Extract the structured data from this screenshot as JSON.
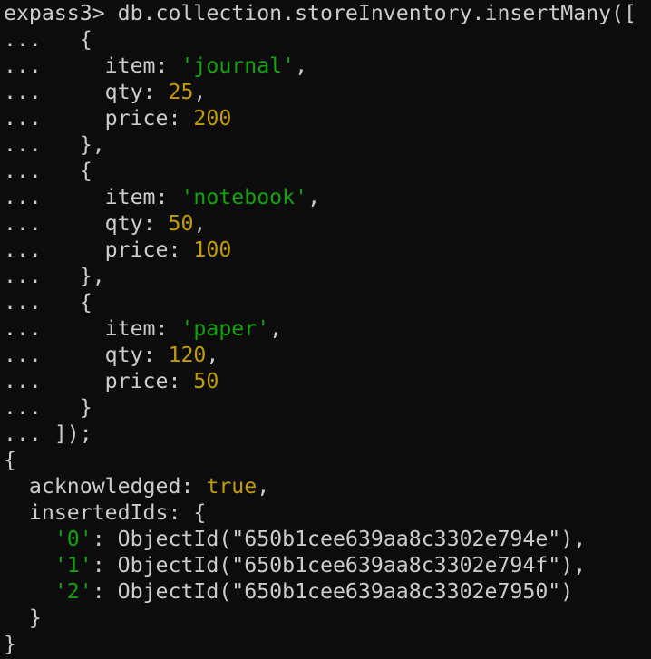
{
  "window": {
    "background": "#0c0c0c"
  },
  "colors": {
    "text": "#cccccc",
    "string": "#13a10e",
    "number": "#c19c00",
    "boolean": "#c19c00"
  },
  "lines": [
    [
      {
        "t": "expass3> db.collection.storeInventory.insertMany([",
        "c": "plain"
      }
    ],
    [
      {
        "t": "...   {",
        "c": "plain"
      }
    ],
    [
      {
        "t": "...     item: ",
        "c": "plain"
      },
      {
        "t": "'journal'",
        "c": "str"
      },
      {
        "t": ",",
        "c": "plain"
      }
    ],
    [
      {
        "t": "...     qty: ",
        "c": "plain"
      },
      {
        "t": "25",
        "c": "num"
      },
      {
        "t": ",",
        "c": "plain"
      }
    ],
    [
      {
        "t": "...     price: ",
        "c": "plain"
      },
      {
        "t": "200",
        "c": "num"
      }
    ],
    [
      {
        "t": "...   },",
        "c": "plain"
      }
    ],
    [
      {
        "t": "...   {",
        "c": "plain"
      }
    ],
    [
      {
        "t": "...     item: ",
        "c": "plain"
      },
      {
        "t": "'notebook'",
        "c": "str"
      },
      {
        "t": ",",
        "c": "plain"
      }
    ],
    [
      {
        "t": "...     qty: ",
        "c": "plain"
      },
      {
        "t": "50",
        "c": "num"
      },
      {
        "t": ",",
        "c": "plain"
      }
    ],
    [
      {
        "t": "...     price: ",
        "c": "plain"
      },
      {
        "t": "100",
        "c": "num"
      }
    ],
    [
      {
        "t": "...   },",
        "c": "plain"
      }
    ],
    [
      {
        "t": "...   {",
        "c": "plain"
      }
    ],
    [
      {
        "t": "...     item: ",
        "c": "plain"
      },
      {
        "t": "'paper'",
        "c": "str"
      },
      {
        "t": ",",
        "c": "plain"
      }
    ],
    [
      {
        "t": "...     qty: ",
        "c": "plain"
      },
      {
        "t": "120",
        "c": "num"
      },
      {
        "t": ",",
        "c": "plain"
      }
    ],
    [
      {
        "t": "...     price: ",
        "c": "plain"
      },
      {
        "t": "50",
        "c": "num"
      }
    ],
    [
      {
        "t": "...   }",
        "c": "plain"
      }
    ],
    [
      {
        "t": "... ]);",
        "c": "plain"
      }
    ],
    [
      {
        "t": "{",
        "c": "plain"
      }
    ],
    [
      {
        "t": "  acknowledged: ",
        "c": "plain"
      },
      {
        "t": "true",
        "c": "bool"
      },
      {
        "t": ",",
        "c": "plain"
      }
    ],
    [
      {
        "t": "  insertedIds: {",
        "c": "plain"
      }
    ],
    [
      {
        "t": "    ",
        "c": "plain"
      },
      {
        "t": "'0'",
        "c": "str"
      },
      {
        "t": ": ObjectId(\"650b1cee639aa8c3302e794e\"),",
        "c": "plain"
      }
    ],
    [
      {
        "t": "    ",
        "c": "plain"
      },
      {
        "t": "'1'",
        "c": "str"
      },
      {
        "t": ": ObjectId(\"650b1cee639aa8c3302e794f\"),",
        "c": "plain"
      }
    ],
    [
      {
        "t": "    ",
        "c": "plain"
      },
      {
        "t": "'2'",
        "c": "str"
      },
      {
        "t": ": ObjectId(\"650b1cee639aa8c3302e7950\")",
        "c": "plain"
      }
    ],
    [
      {
        "t": "  }",
        "c": "plain"
      }
    ],
    [
      {
        "t": "}",
        "c": "plain"
      }
    ]
  ]
}
